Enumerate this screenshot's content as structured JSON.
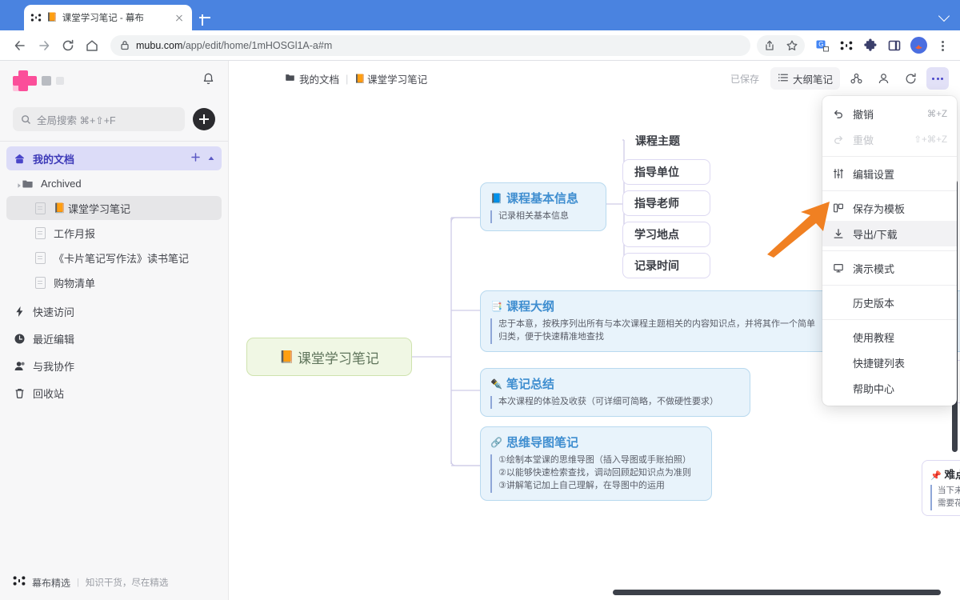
{
  "browser": {
    "tab": {
      "title": "课堂学习笔记 - 幕布",
      "emoji": "📙",
      "favicon_name": "mubu-favicon",
      "close_label": "×"
    },
    "new_tab_label": "+",
    "url_host": "mubu.com",
    "url_path": "/app/edit/home/1mHOSGl1A-a#m",
    "nav": {
      "back": "←",
      "forward": "→",
      "reload": "⟳",
      "home": "⌂"
    },
    "right_icons": [
      "share-icon",
      "bookmark-star-icon",
      "translate-icon",
      "mubu-extension-icon",
      "puzzle-extension-icon",
      "side-panel-icon",
      "profile-avatar",
      "chrome-menu-icon"
    ]
  },
  "sidebar": {
    "logo_name": "mubu-logo",
    "notification_icon": "bell-icon",
    "search": {
      "placeholder": "全局搜索 ⌘+⇧+F",
      "icon": "search-icon"
    },
    "add_button_label": "+",
    "items": [
      {
        "label": "我的文档",
        "icon": "home-icon",
        "state": "active",
        "indent": 0,
        "right": [
          "plus-icon",
          "chevron-up-icon"
        ]
      },
      {
        "label": "Archived",
        "icon": "folder-icon",
        "state": "normal",
        "indent": 1,
        "caret": true
      },
      {
        "label": "课堂学习笔记",
        "emoji": "📙",
        "icon": "doc-icon",
        "state": "selected",
        "indent": 2
      },
      {
        "label": "工作月报",
        "icon": "doc-icon",
        "state": "normal",
        "indent": 2
      },
      {
        "label": "《卡片笔记写作法》读书笔记",
        "icon": "doc-icon",
        "state": "normal",
        "indent": 2
      },
      {
        "label": "购物清单",
        "icon": "doc-icon",
        "state": "normal",
        "indent": 2
      },
      {
        "label": "快速访问",
        "icon": "lightning-icon",
        "state": "normal",
        "indent": 0
      },
      {
        "label": "最近编辑",
        "icon": "clock-icon",
        "state": "normal",
        "indent": 0
      },
      {
        "label": "与我协作",
        "icon": "people-icon",
        "state": "normal",
        "indent": 0
      },
      {
        "label": "回收站",
        "icon": "trash-icon",
        "state": "normal",
        "indent": 0
      }
    ],
    "footer": {
      "icon": "mubu-mark-icon",
      "title": "幕布精选",
      "sep": "|",
      "subtitle": "知识干货，尽在精选"
    }
  },
  "toolbar": {
    "breadcrumb": [
      {
        "label": "我的文档",
        "icon": "folder-icon"
      },
      {
        "label": "课堂学习笔记",
        "emoji": "📙"
      }
    ],
    "breadcrumb_sep": "|",
    "saved_status": "已保存",
    "outline_button": "大纲笔记",
    "outline_icon": "list-icon",
    "share_icon": "share-user-icon",
    "members_icon": "user-icon",
    "refresh_icon": "refresh-icon",
    "more_icon": "more-dots-icon"
  },
  "menu": {
    "items": [
      {
        "label": "撤销",
        "shortcut": "⌘+Z",
        "icon": "undo-icon",
        "disabled": false,
        "highlighted": false
      },
      {
        "label": "重做",
        "shortcut": "⇧+⌘+Z",
        "icon": "redo-icon",
        "disabled": true,
        "highlighted": false
      },
      {
        "sep": true
      },
      {
        "label": "编辑设置",
        "shortcut": "",
        "icon": "sliders-icon",
        "disabled": false,
        "highlighted": false
      },
      {
        "sep": true
      },
      {
        "label": "保存为模板",
        "shortcut": "",
        "icon": "template-icon",
        "disabled": false,
        "highlighted": false
      },
      {
        "label": "导出/下载",
        "shortcut": "",
        "icon": "download-icon",
        "disabled": false,
        "highlighted": true
      },
      {
        "sep": true
      },
      {
        "label": "演示模式",
        "shortcut": "",
        "icon": "present-icon",
        "disabled": false,
        "highlighted": false
      },
      {
        "sep": true
      },
      {
        "label": "历史版本",
        "shortcut": "",
        "icon": "",
        "disabled": false,
        "highlighted": false
      },
      {
        "sep": true
      },
      {
        "label": "使用教程",
        "shortcut": "",
        "icon": "",
        "disabled": false,
        "highlighted": false
      },
      {
        "label": "快捷键列表",
        "shortcut": "",
        "icon": "",
        "disabled": false,
        "highlighted": false
      },
      {
        "label": "帮助中心",
        "shortcut": "",
        "icon": "",
        "disabled": false,
        "highlighted": false
      }
    ]
  },
  "mindmap": {
    "root": {
      "emoji": "📙",
      "title": "课堂学习笔记"
    },
    "branches": [
      {
        "title": "课程基本信息",
        "emoji": "📘",
        "desc": "记录相关基本信息",
        "children": [
          "课程主题",
          "指导单位",
          "指导老师",
          "学习地点",
          "记录时间"
        ]
      },
      {
        "title": "课程大纲",
        "emoji": "📑",
        "desc": "忠于本意，按秩序列出所有与本次课程主题相关的内容知识点，并将其作一个简单\n归类，便于快速精准地查找"
      },
      {
        "title": "笔记总结",
        "emoji": "✒️",
        "desc": "本次课程的体验及收获（可详细可简略，不做硬性要求）"
      },
      {
        "title": "思维导图笔记",
        "emoji": "🔗",
        "desc": "①绘制本堂课的思维导图（插入导图或手账拍照）\n②以能够快速检索查找，调动回顾起知识点为准则\n③讲解笔记加上自己理解，在导图中的运用"
      }
    ],
    "right_partial": {
      "emoji": "📌",
      "title": "难点",
      "desc": "当下未\n需要花"
    }
  },
  "annotation": {
    "arrow_color": "#f08022",
    "points_to": "导出/下载"
  }
}
